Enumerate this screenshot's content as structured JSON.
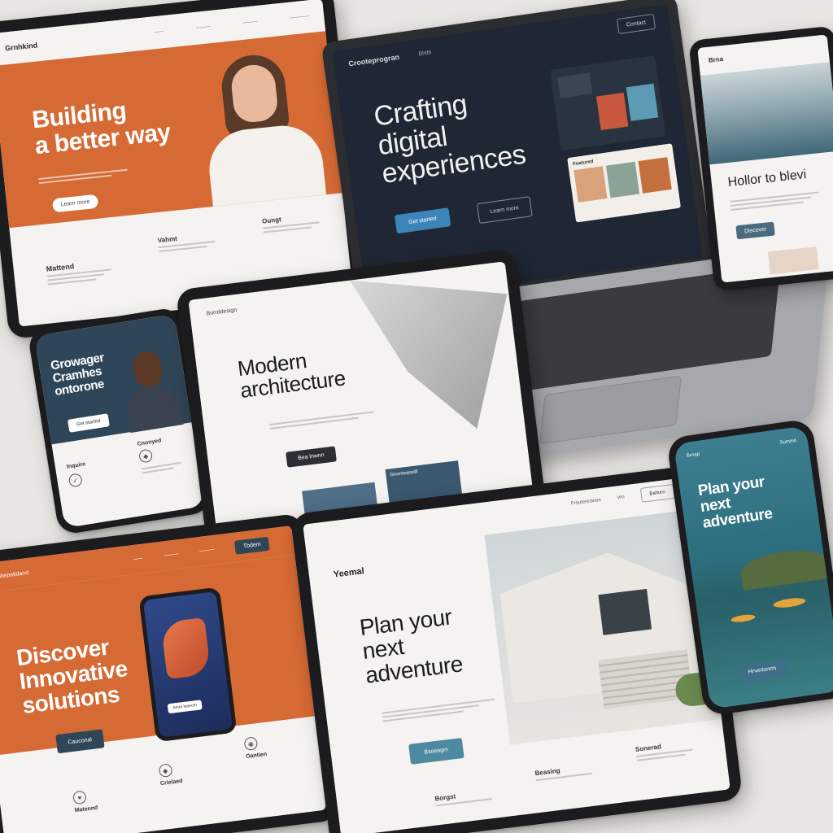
{
  "colors": {
    "orange": "#d66a35",
    "navy": "#1e2733",
    "teal": "#3d6f88",
    "slate": "#2f4658",
    "background": "#e8e6e3"
  },
  "tablet_top_left": {
    "brand": "Grnhkind",
    "nav": [
      "——",
      "———",
      "———",
      "————"
    ],
    "headline_1": "Building",
    "headline_2": "a better way",
    "cta": "Learn more",
    "col1_title": "Mattend",
    "col2_title": "Vahmt",
    "col3_title": "Oungt"
  },
  "laptop": {
    "brand": "Crooteprogran",
    "nav_item": "Bhlth",
    "nav_button": "Contact",
    "headline_1": "Crafting",
    "headline_2": "digital",
    "headline_3": "experiences",
    "primary_cta": "Get started",
    "secondary_cta": "Learn more",
    "card_label": "Featured"
  },
  "tablet_top_right": {
    "brand": "Brna",
    "headline": "Hollor to blevi",
    "cta": "Discover"
  },
  "phone_left": {
    "headline_1": "Growager",
    "headline_2": "Cramhes",
    "headline_3": "ontorone",
    "cta": "Get started",
    "label_1": "Inquire",
    "label_2": "Cnonyed"
  },
  "tablet_center": {
    "brand": "Borrddesign",
    "headline_1": "Modern",
    "headline_2": "architecture",
    "cta": "Bea lnwnn",
    "card_label": "Gnomearedli"
  },
  "tablet_bottom_left": {
    "brand": "Hitepatidarxt",
    "nav": [
      "——",
      "———",
      "———"
    ],
    "nav_button": "Tbdem",
    "headline_1": "Discover",
    "headline_2": "Innovative",
    "headline_3": "solutions",
    "cta": "Cauconal",
    "phone_cta": "Amra laaeom",
    "feature_1": "Mateond",
    "feature_2": "Crielaed",
    "feature_3": "Oantien"
  },
  "tablet_bottom_center": {
    "brand": "Yeemal",
    "nav": [
      "Frouteresinon",
      "Vrn"
    ],
    "nav_button": "Bahurn",
    "headline_1": "Plan your",
    "headline_2": "next",
    "headline_3": "adventure",
    "cta": "Bsoeagm",
    "feature_1": "Borgst",
    "feature_2": "Beasing",
    "feature_3": "Sonerad"
  },
  "phone_right": {
    "brand": "Summit",
    "nav": "Brnap",
    "headline_1": "Plan your",
    "headline_2": "next",
    "headline_3": "adventure",
    "cta": "Hrverlonrm"
  }
}
